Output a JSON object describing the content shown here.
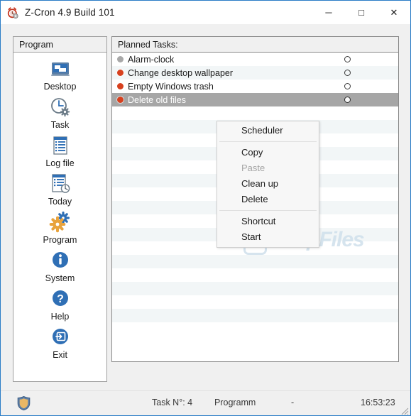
{
  "window": {
    "title": "Z-Cron 4.9 Build 101",
    "icon": "alarm-clock-icon",
    "accent_color": "#2a7cc7",
    "controls": {
      "minimize": "─",
      "maximize": "□",
      "close": "✕"
    }
  },
  "sidebar": {
    "header": "Program",
    "items": [
      {
        "label": "Desktop",
        "icon": "desktop-icon"
      },
      {
        "label": "Task",
        "icon": "clock-gear-icon"
      },
      {
        "label": "Log file",
        "icon": "document-list-icon"
      },
      {
        "label": "Today",
        "icon": "document-clock-icon"
      },
      {
        "label": "Program",
        "icon": "gears-icon"
      },
      {
        "label": "System",
        "icon": "info-icon"
      },
      {
        "label": "Help",
        "icon": "question-icon"
      },
      {
        "label": "Exit",
        "icon": "exit-icon"
      }
    ]
  },
  "task_list": {
    "header": "Planned Tasks:",
    "rows": [
      {
        "name": "Alarm-clock",
        "status_color": "#a8a8a8",
        "enabled": false,
        "selected": false,
        "indicator": "circle-empty"
      },
      {
        "name": "Change desktop wallpaper",
        "status_color": "#d7401e",
        "enabled": true,
        "selected": false,
        "indicator": "circle-empty"
      },
      {
        "name": "Empty Windows trash",
        "status_color": "#d7401e",
        "enabled": true,
        "selected": false,
        "indicator": "circle-empty"
      },
      {
        "name": "Delete old files",
        "status_color": "#d7401e",
        "enabled": true,
        "selected": true,
        "indicator": "circle-empty"
      }
    ],
    "empty_row_count": 17
  },
  "context_menu": {
    "items": [
      {
        "label": "Scheduler",
        "disabled": false
      },
      {
        "separator": true
      },
      {
        "label": "Copy",
        "disabled": false
      },
      {
        "label": "Paste",
        "disabled": true
      },
      {
        "label": "Clean up",
        "disabled": false
      },
      {
        "label": "Delete",
        "disabled": false
      },
      {
        "separator": true
      },
      {
        "label": "Shortcut",
        "disabled": false
      },
      {
        "label": "Start",
        "disabled": false
      }
    ]
  },
  "status_bar": {
    "shield_icon": "shield-icon",
    "task_count": "Task N°: 4",
    "mode": "Programm",
    "extra": "-",
    "time": "16:53:23"
  },
  "watermark": {
    "badge": "S",
    "text": "SnapFiles"
  }
}
